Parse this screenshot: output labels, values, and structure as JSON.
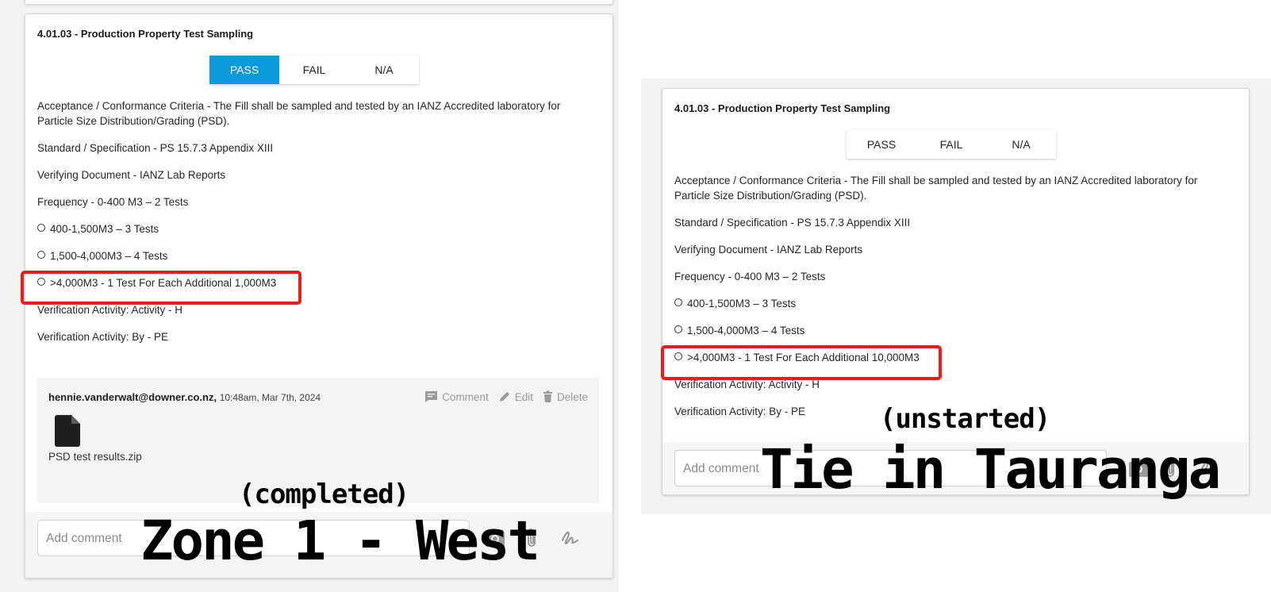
{
  "left": {
    "title": "4.01.03 - Production Property Test Sampling",
    "buttons": {
      "pass": "PASS",
      "fail": "FAIL",
      "na": "N/A",
      "active": "pass"
    },
    "criteria": "Acceptance / Conformance Criteria - The Fill shall be sampled and tested by an IANZ Accredited laboratory for Particle Size Distribution/Grading (PSD).",
    "standard": "Standard / Specification - PS 15.7.3 Appendix XIII",
    "verifying_doc": "Verifying Document - IANZ Lab Reports",
    "frequency": "Frequency - 0-400 M3 – 2 Tests",
    "bullet1": "400-1,500M3 – 3 Tests",
    "bullet2": "1,500-4,000M3 – 4 Tests",
    "bullet3": ">4,000M3 - 1 Test For Each Additional 1,000M3",
    "activity": "Verification Activity: Activity - H",
    "by": "Verification Activity: By - PE",
    "comment": {
      "user": "hennie.vanderwalt@downer.co.nz,",
      "timestamp": "10:48am, Mar 7th, 2024",
      "comment_label": "Comment",
      "edit_label": "Edit",
      "delete_label": "Delete",
      "file_name": "PSD test results.zip"
    },
    "add_comment_placeholder": "Add comment",
    "overlay_status": "(completed)",
    "overlay_name": "Zone 1 - West"
  },
  "right": {
    "title": "4.01.03 - Production Property Test Sampling",
    "buttons": {
      "pass": "PASS",
      "fail": "FAIL",
      "na": "N/A",
      "active": "none"
    },
    "criteria": "Acceptance / Conformance Criteria - The Fill shall be sampled and tested by an IANZ Accredited laboratory for Particle Size Distribution/Grading (PSD).",
    "standard": "Standard / Specification - PS 15.7.3 Appendix XIII",
    "verifying_doc": "Verifying Document - IANZ Lab Reports",
    "frequency": "Frequency - 0-400 M3 – 2 Tests",
    "bullet1": "400-1,500M3 – 3 Tests",
    "bullet2": "1,500-4,000M3 – 4 Tests",
    "bullet3": ">4,000M3 - 1 Test For Each Additional 10,000M3",
    "activity": "Verification Activity: Activity - H",
    "by": "Verification Activity: By - PE",
    "add_comment_placeholder": "Add comment",
    "overlay_status": "(unstarted)",
    "overlay_name": "Tie in Tauranga"
  },
  "colors": {
    "accent": "#0b99d9",
    "highlight": "#ee1b1b"
  },
  "icons": [
    "comment-icon",
    "pencil-icon",
    "trash-icon",
    "file-icon",
    "camera-icon",
    "paperclip-icon",
    "signature-icon"
  ]
}
